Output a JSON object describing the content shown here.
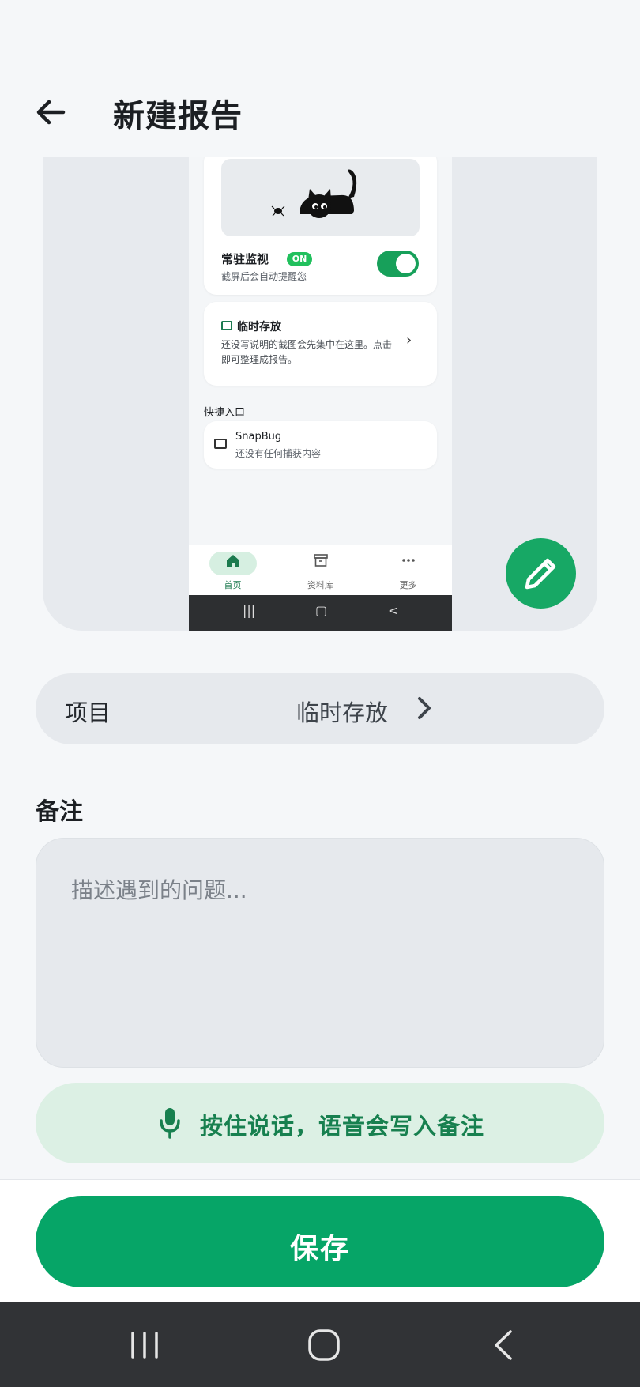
{
  "header": {
    "title": "新建报告",
    "back_icon": "arrow-left-icon"
  },
  "preview": {
    "monitor": {
      "title": "常驻监视",
      "badge": "ON",
      "subtitle": "截屏后会自动提醒您",
      "enabled": true
    },
    "temp_storage": {
      "title": "临时存放",
      "description": "还没写说明的截图会先集中在这里。点击即可整理成报告。"
    },
    "quick_entry_label": "快捷入口",
    "quick_entry": {
      "title": "SnapBug",
      "subtitle": "还没有任何捕获内容"
    },
    "bottom_nav": [
      {
        "label": "首页",
        "icon": "home-icon",
        "active": true
      },
      {
        "label": "资料库",
        "icon": "archive-icon",
        "active": false
      },
      {
        "label": "更多",
        "icon": "more-icon",
        "active": false
      }
    ]
  },
  "fab": {
    "icon": "pencil-icon"
  },
  "project": {
    "label": "项目",
    "value": "临时存放"
  },
  "notes": {
    "heading": "备注",
    "placeholder": "描述遇到的问题...",
    "value": ""
  },
  "voice": {
    "label": "按住说话，语音会写入备注",
    "icon": "microphone-icon"
  },
  "save": {
    "label": "保存"
  },
  "colors": {
    "accent": "#06a567",
    "accent_light": "#dcf0e4",
    "accent_text": "#17804f"
  }
}
